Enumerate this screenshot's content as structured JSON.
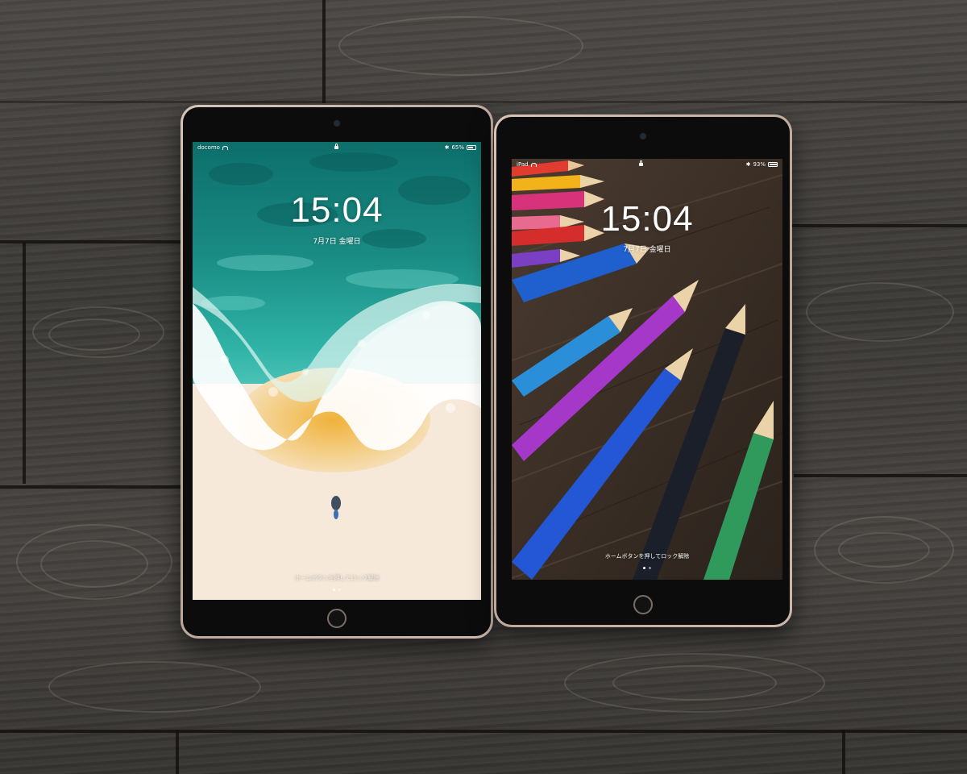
{
  "scene": {
    "floor_color": "#3b3936",
    "device_color": "#c8b2a6"
  },
  "left_ipad": {
    "carrier": "docomo",
    "battery": "65%",
    "battery_level": 0.65,
    "time": "15:04",
    "date": "7月7日 金曜日",
    "unlock_hint": "ホームボタンを押してロック解除",
    "wallpaper": "aerial-beach-turquoise-wave",
    "icons": [
      "wifi-icon",
      "lock-icon",
      "bluetooth-icon",
      "battery-icon"
    ]
  },
  "right_ipad": {
    "carrier": "iPad",
    "battery": "93%",
    "battery_level": 0.93,
    "time": "15:04",
    "date": "7月7日 金曜日",
    "unlock_hint": "ホームボタンを押してロック解除",
    "wallpaper": "colored-pencils-on-wood",
    "icons": [
      "wifi-icon",
      "lock-icon",
      "bluetooth-icon",
      "battery-icon"
    ]
  }
}
